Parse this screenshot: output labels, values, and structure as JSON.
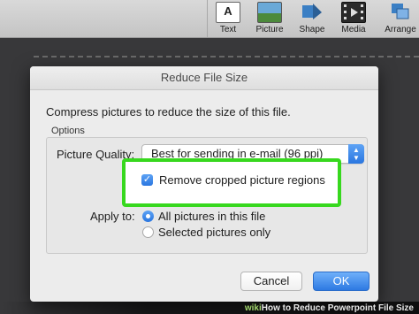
{
  "ribbon": {
    "buttons": [
      {
        "label": "Text",
        "icon": "text-box-icon"
      },
      {
        "label": "Picture",
        "icon": "picture-icon"
      },
      {
        "label": "Shape",
        "icon": "shape-icon"
      },
      {
        "label": "Media",
        "icon": "media-icon"
      },
      {
        "label": "Arrange",
        "icon": "arrange-icon"
      }
    ]
  },
  "dialog": {
    "title": "Reduce File Size",
    "description": "Compress pictures to reduce the size of this file.",
    "options_legend": "Options",
    "picture_quality": {
      "label": "Picture Quality:",
      "value": "Best for sending in e-mail (96 ppi)"
    },
    "remove_cropped": {
      "label": "Remove cropped picture regions",
      "checked": true
    },
    "apply_to": {
      "label": "Apply to:",
      "options": [
        {
          "label": "All pictures in this file",
          "selected": true
        },
        {
          "label": "Selected pictures only",
          "selected": false
        }
      ]
    },
    "cancel_label": "Cancel",
    "ok_label": "OK"
  },
  "highlight_color": "#37d81e",
  "accent_color": "#2a76e0",
  "watermark": {
    "brand_prefix": "wiki",
    "brand_suffix": "How",
    "title": " to Reduce Powerpoint File Size"
  }
}
